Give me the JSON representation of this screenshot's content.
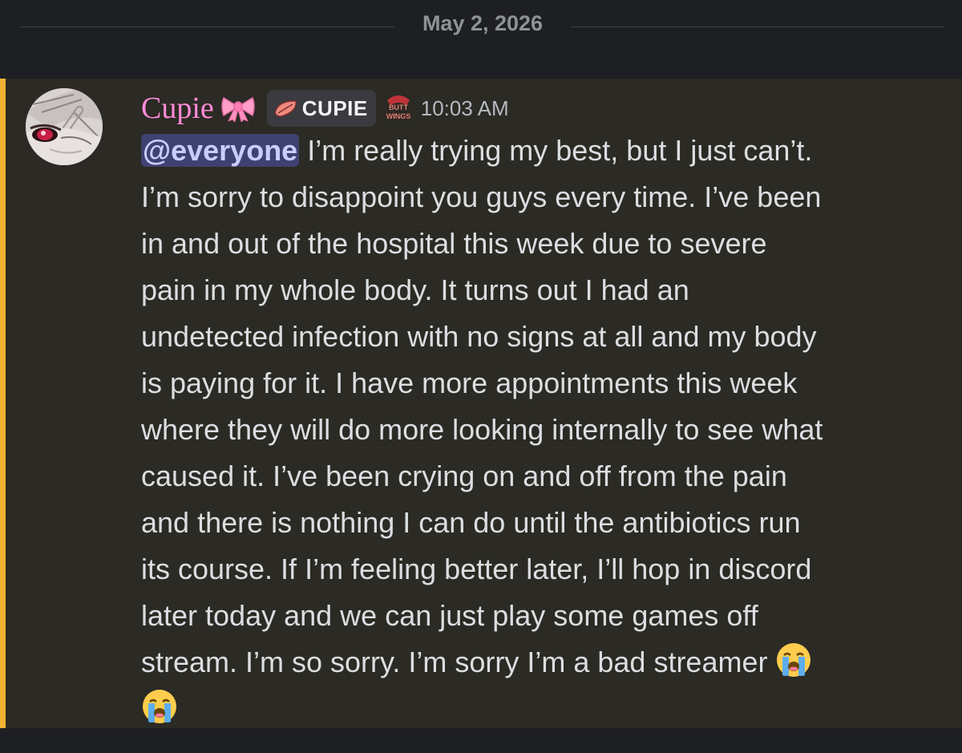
{
  "divider": {
    "date": "May 2, 2026"
  },
  "message": {
    "username": "Cupie",
    "username_emoji": "ribbon-emoji",
    "tag_label": "CUPIE",
    "tag_icon": "pink-leaf-icon",
    "badge_icon": "butt-wings-badge-icon",
    "badge_text_top": "BUTT",
    "badge_text_bottom": "WINGS",
    "timestamp": "10:03 AM",
    "mention": "@everyone",
    "lines": [
      " I’m really trying my best, but I just can’t.",
      "I’m sorry to disappoint you guys every time. I’ve been",
      "in and out of the hospital this week due to severe",
      "pain in my whole body. It turns out I had an",
      "undetected infection with no signs at all and my body",
      "is paying for it. I have more appointments this week",
      "where they will do more looking internally to see what",
      "caused it. I’ve been crying on and off from the pain",
      "and there is nothing I can do until the antibiotics run",
      "its course. If I’m feeling better later, I’ll hop in discord",
      "later today and we can just play some games off",
      "stream. I’m so sorry. I’m sorry I’m a bad streamer "
    ],
    "trailing_emoji": "loudly-crying-face-emoji"
  },
  "colors": {
    "background": "#1e1f22",
    "highlight": "#2b2a24",
    "mention_bar": "#f0b232",
    "username": "#ff8bd7",
    "mention_bg": "#3d4270",
    "text": "#dbdee1"
  }
}
